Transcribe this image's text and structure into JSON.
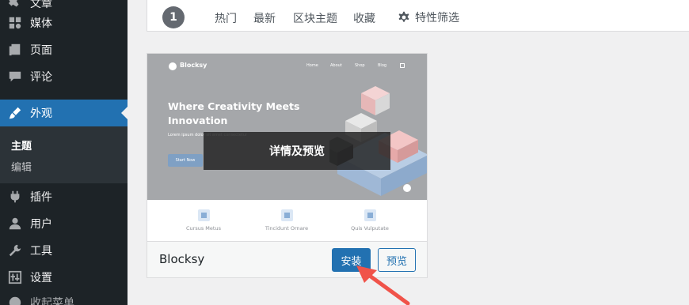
{
  "sidebar": {
    "items": [
      {
        "label": "文章",
        "icon": "pin-icon"
      },
      {
        "label": "媒体",
        "icon": "media-icon"
      },
      {
        "label": "页面",
        "icon": "page-icon"
      },
      {
        "label": "评论",
        "icon": "comment-icon"
      },
      {
        "label": "外观",
        "icon": "appearance-brush-icon"
      },
      {
        "label": "插件",
        "icon": "plugin-icon"
      },
      {
        "label": "用户",
        "icon": "user-icon"
      },
      {
        "label": "工具",
        "icon": "wrench-icon"
      },
      {
        "label": "设置",
        "icon": "settings-sliders-icon"
      },
      {
        "label": "收起菜单",
        "icon": "collapse-icon"
      }
    ],
    "submenu": {
      "themes": "主题",
      "editor": "编辑"
    },
    "active_color": "#2271b1"
  },
  "filter_bar": {
    "count": "1",
    "tabs": [
      "热门",
      "最新",
      "区块主题",
      "收藏"
    ],
    "feature_filter": "特性筛选",
    "feature_icon": "gear-icon"
  },
  "theme_card": {
    "screenshot": {
      "logo": "Blocksy",
      "nav": [
        "Home",
        "About",
        "Shop",
        "Blog"
      ],
      "hero_title": "Where Creativity Meets Innovation",
      "hero_subtitle": "Lorem ipsum dolor sit amet consectetur",
      "hero_button": "Start Now",
      "features": [
        "Cursus Metus",
        "Tincidunt Ornare",
        "Quis Vulputate"
      ]
    },
    "overlay": "详情及预览",
    "name": "Blocksy",
    "install": "安装",
    "preview": "预览"
  },
  "annotation": {
    "arrow_color": "#f0534a"
  }
}
